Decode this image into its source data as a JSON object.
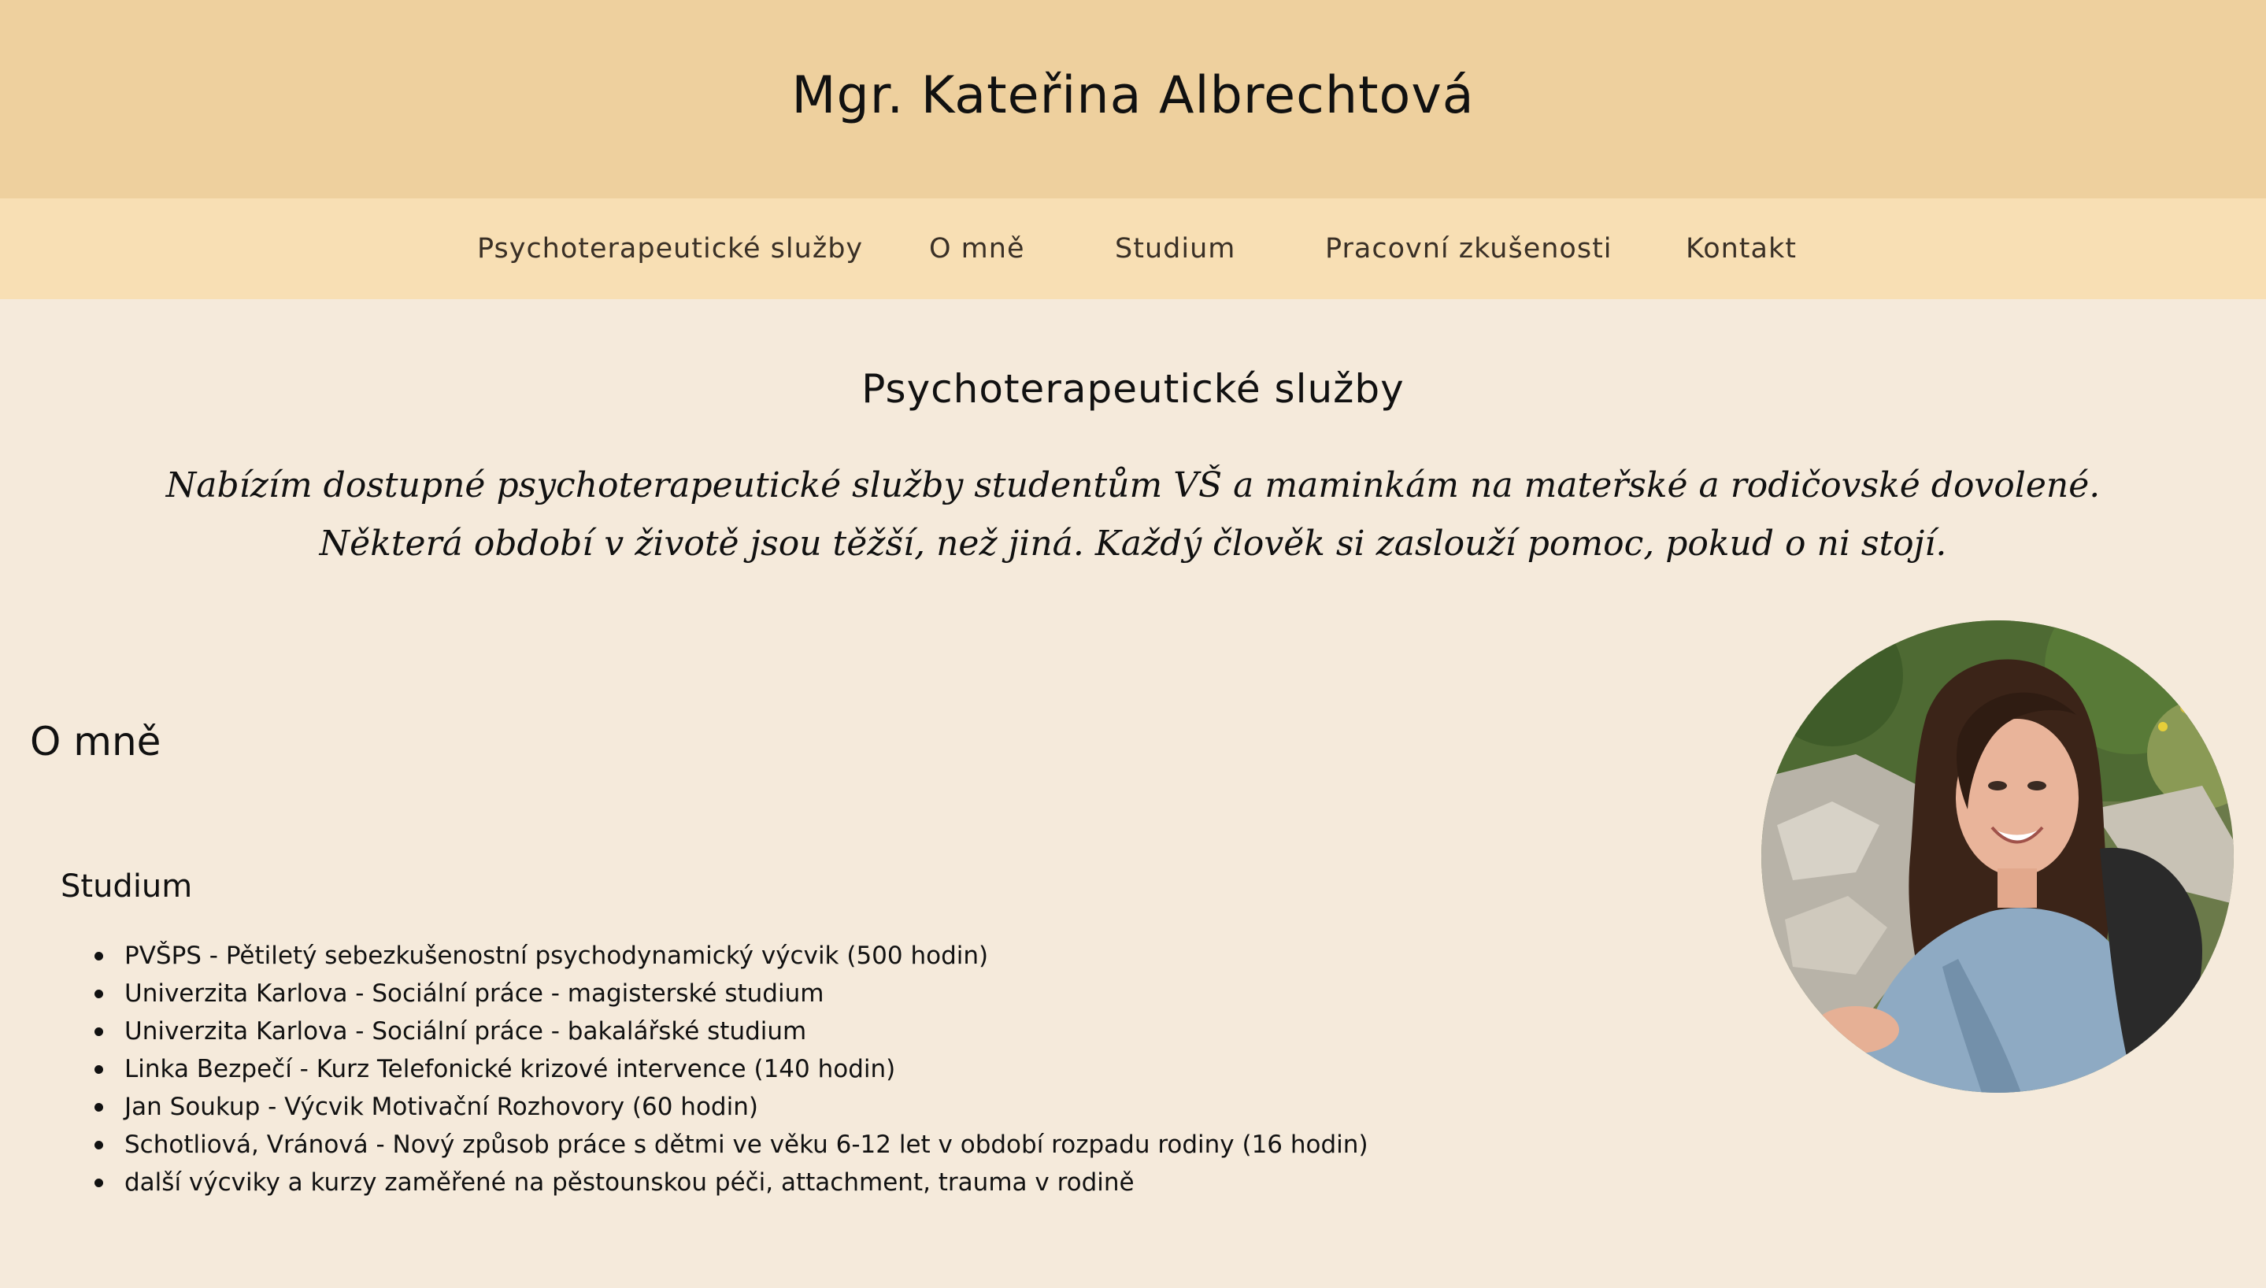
{
  "header": {
    "title": "Mgr. Kateřina Albrechtová"
  },
  "nav": {
    "items": [
      {
        "label": "Psychoterapeutické služby"
      },
      {
        "label": "O mně"
      },
      {
        "label": "Studium"
      },
      {
        "label": "Pracovní zkušenosti"
      },
      {
        "label": "Kontakt"
      }
    ]
  },
  "services": {
    "title": "Psychoterapeutické služby",
    "tagline_line1": "Nabízím dostupné psychoterapeutické služby studentům VŠ a maminkám na mateřské a rodičovské dovolené.",
    "tagline_line2": "Některá období v životě jsou těžší, než jiná. Každý člověk si zaslouží pomoc, pokud o ni stojí."
  },
  "about": {
    "title": "O mně",
    "portrait_icon": "portrait-photo"
  },
  "studium": {
    "title": "Studium",
    "items": [
      "PVŠPS - Pětiletý sebezkušenostní psychodynamický výcvik (500 hodin)",
      "Univerzita Karlova - Sociální práce - magisterské studium",
      "Univerzita Karlova - Sociální práce - bakalářské studium",
      "Linka Bezpečí - Kurz Telefonické krizové intervence (140 hodin)",
      "Jan Soukup - Výcvik Motivační Rozhovory (60 hodin)",
      "Schotliová, Vránová - Nový způsob práce s dětmi ve věku 6-12 let v období rozpadu rodiny (16 hodin)",
      "další výcviky a kurzy zaměřené na pěstounskou péči, attachment, trauma v rodině"
    ]
  },
  "colors": {
    "header_bg": "#eed09e",
    "nav_bg": "#f8dfb4",
    "page_bg": "#f5eadb"
  }
}
